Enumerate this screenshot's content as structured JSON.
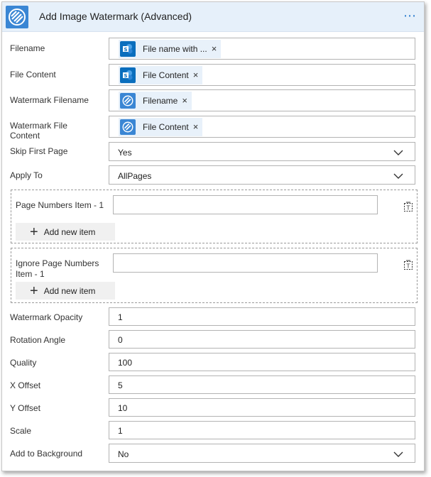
{
  "header": {
    "title": "Add Image Watermark (Advanced)",
    "menu": "⋯",
    "colors": {
      "background": "#e6f0fa",
      "icon": "#3a86d4",
      "menu": "#2f7fcf"
    }
  },
  "fields": {
    "filename": {
      "label": "Filename",
      "token": "File name with ...",
      "token_icon": "sharepoint-icon"
    },
    "file_content": {
      "label": "File Content",
      "token": "File Content",
      "token_icon": "sharepoint-icon"
    },
    "watermark_filename": {
      "label": "Watermark Filename",
      "token": "Filename",
      "token_icon": "watermark-action-icon"
    },
    "watermark_file_content": {
      "label": "Watermark File Content",
      "token": "File Content",
      "token_icon": "watermark-action-icon"
    },
    "skip_first_page": {
      "label": "Skip First Page",
      "value": "Yes"
    },
    "apply_to": {
      "label": "Apply To",
      "value": "AllPages"
    },
    "watermark_opacity": {
      "label": "Watermark Opacity",
      "value": "1"
    },
    "rotation_angle": {
      "label": "Rotation Angle",
      "value": "0"
    },
    "quality": {
      "label": "Quality",
      "value": "100"
    },
    "x_offset": {
      "label": "X Offset",
      "value": "5"
    },
    "y_offset": {
      "label": "Y Offset",
      "value": "10"
    },
    "scale": {
      "label": "Scale",
      "value": "1"
    },
    "add_to_background": {
      "label": "Add to Background",
      "value": "No"
    }
  },
  "arrays": {
    "page_numbers": {
      "item_label": "Page Numbers Item - 1",
      "value": "",
      "add_label": "Add new item"
    },
    "ignore_page_numbers": {
      "item_label": "Ignore Page Numbers Item - 1",
      "value": "",
      "add_label": "Add new item"
    }
  },
  "token_close": "×",
  "colors": {
    "sharepoint": "#0a6ebd",
    "watermark": "#3a86d4",
    "token_bg": "#e8f1fa"
  }
}
